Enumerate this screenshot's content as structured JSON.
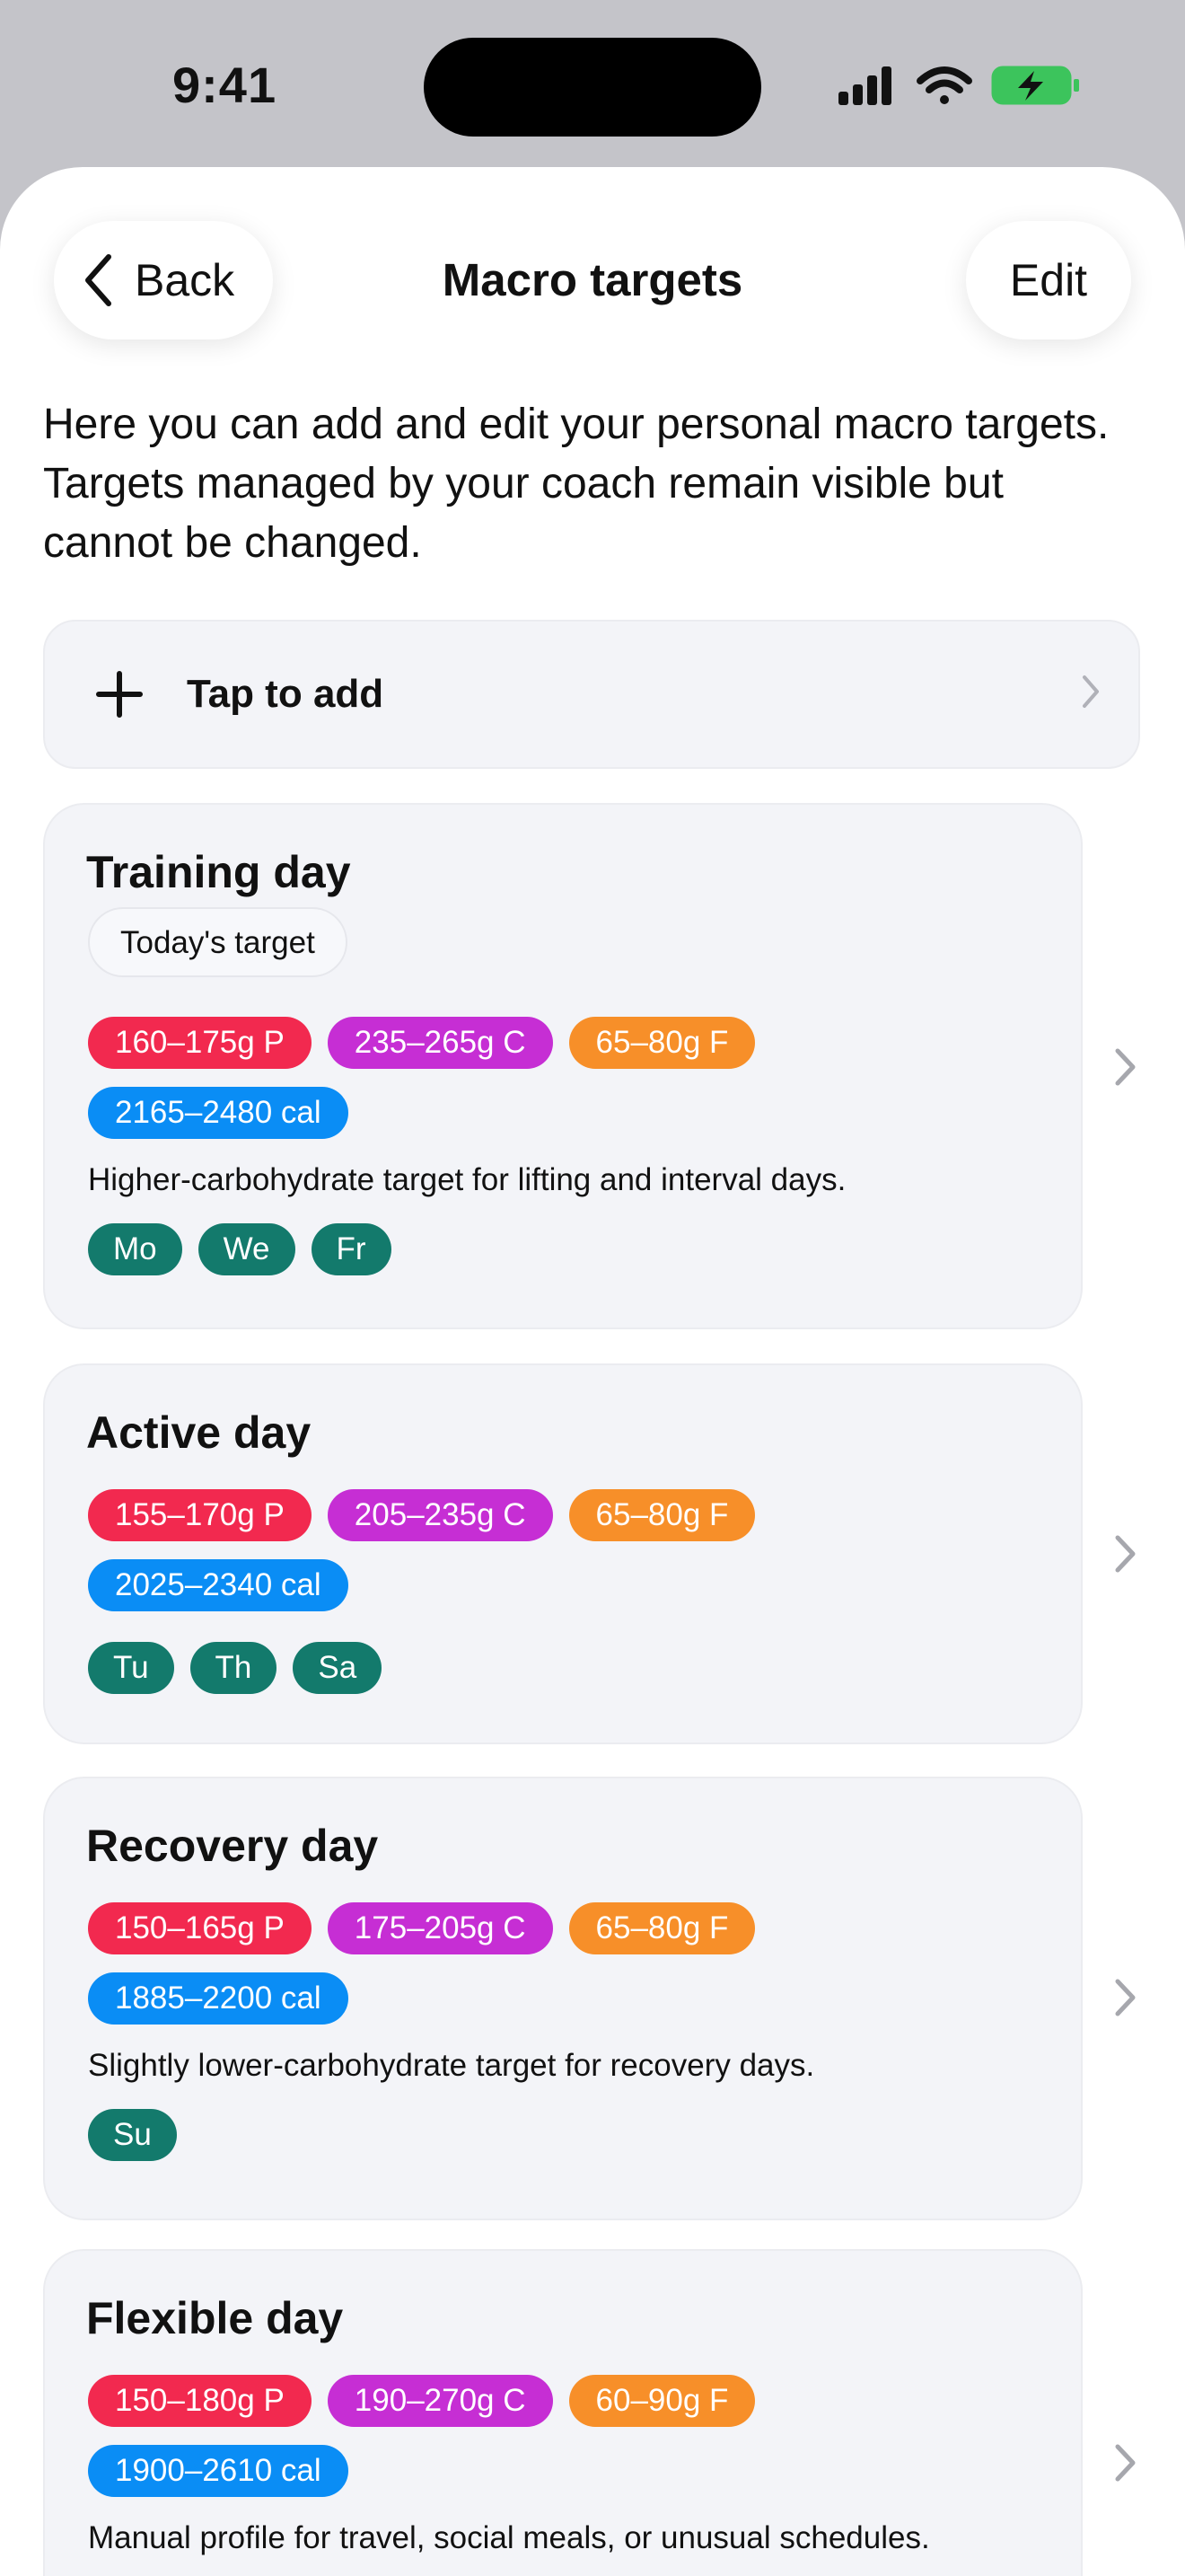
{
  "status": {
    "time": "9:41"
  },
  "nav": {
    "back_label": "Back",
    "title": "Macro targets",
    "edit_label": "Edit"
  },
  "intro": "Here you can add and edit your personal macro targets. Targets managed by your coach remain visible but cannot be changed.",
  "add": {
    "label": "Tap to add"
  },
  "colors": {
    "protein": "#f2294f",
    "carbs": "#c62ed4",
    "fat": "#f78f29",
    "calories": "#0a8df5",
    "day": "#137a6c",
    "battery": "#3cc45c"
  },
  "icons": [
    "chevron-left-icon",
    "plus-icon",
    "chevron-right-icon",
    "signal-icon",
    "wifi-icon",
    "battery-charging-icon"
  ],
  "profiles": [
    {
      "title": "Training day",
      "badge": "Today's target",
      "protein": "160–175g P",
      "carbs": "235–265g C",
      "fat": "65–80g F",
      "calories": "2165–2480 cal",
      "description": "Higher-carbohydrate target for lifting and interval days.",
      "days": [
        "Mo",
        "We",
        "Fr"
      ]
    },
    {
      "title": "Active day",
      "protein": "155–170g P",
      "carbs": "205–235g C",
      "fat": "65–80g F",
      "calories": "2025–2340 cal",
      "days": [
        "Tu",
        "Th",
        "Sa"
      ]
    },
    {
      "title": "Recovery day",
      "protein": "150–165g P",
      "carbs": "175–205g C",
      "fat": "65–80g F",
      "calories": "1885–2200 cal",
      "description": "Slightly lower-carbohydrate target for recovery days.",
      "days": [
        "Su"
      ]
    },
    {
      "title": "Flexible day",
      "protein": "150–180g P",
      "carbs": "190–270g C",
      "fat": "60–90g F",
      "calories": "1900–2610 cal",
      "description": "Manual profile for travel, social meals, or unusual schedules."
    }
  ]
}
